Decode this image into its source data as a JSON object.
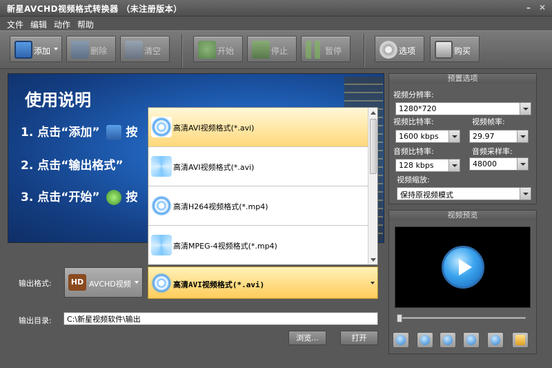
{
  "window": {
    "title": "新星AVCHD视频格式转换器 （未注册版本）"
  },
  "menu": [
    "文件",
    "编辑",
    "动作",
    "帮助"
  ],
  "toolbar": {
    "add": "添加",
    "delete": "删除",
    "clear": "清空",
    "start": "开始",
    "stop": "停止",
    "pause": "暂停",
    "options": "选项",
    "buy": "购买"
  },
  "banner": {
    "title": "使用说明",
    "step1": "1. 点击“添加”",
    "step2": "2. 点击“输出格式”",
    "step3": "3. 点击“开始”",
    "step_tail": "按"
  },
  "format_list": {
    "items": [
      {
        "label": "高清AVI视频格式(*.avi)",
        "selected": true
      },
      {
        "label": "高清AVI视频格式(*.avi)",
        "selected": false
      },
      {
        "label": "高清H264视频格式(*.mp4)",
        "selected": false
      },
      {
        "label": "高清MPEG-4视频格式(*.mp4)",
        "selected": false
      }
    ]
  },
  "output": {
    "format_label": "输出格式:",
    "category_badge": "HD",
    "category": "AVCHD视频",
    "format_value": "高清AVI视频格式(*.avi)",
    "dir_label": "输出目录:",
    "dir_value": "C:\\新星视频软件\\输出",
    "browse": "浏览...",
    "open": "打开"
  },
  "presets": {
    "title": "预置选项",
    "resolution_label": "视频分辨率:",
    "resolution": "1280*720",
    "video_bitrate_label": "视频比特率:",
    "video_bitrate": "1600 kbps",
    "framerate_label": "视频帧率:",
    "framerate": "29.97",
    "audio_bitrate_label": "音频比特率:",
    "audio_bitrate": "128 kbps",
    "samplerate_label": "音频采样率:",
    "samplerate": "48000",
    "scale_label": "视频缩放:",
    "scale": "保持原视频模式"
  },
  "preview": {
    "title": "视频预览"
  },
  "colors": {
    "banner": "#1f5fb5",
    "selected_item": "#ffd87a",
    "background": "#585858"
  }
}
